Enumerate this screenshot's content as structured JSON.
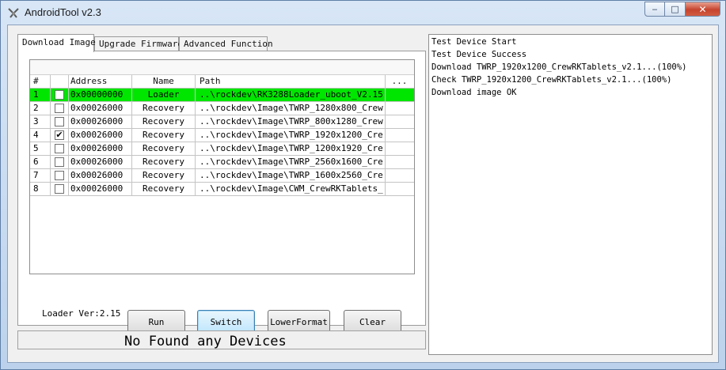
{
  "window": {
    "title": "AndroidTool v2.3"
  },
  "tabs": [
    {
      "label": "Download Image",
      "active": true
    },
    {
      "label": "Upgrade Firmware",
      "active": false
    },
    {
      "label": "Advanced Function",
      "active": false
    }
  ],
  "table": {
    "columns": [
      "#",
      "",
      "Address",
      "Name",
      "Path",
      "..."
    ],
    "rows": [
      {
        "num": "1",
        "checked": false,
        "address": "0x00000000",
        "name": "Loader",
        "path": "..\\rockdev\\RK3288Loader_uboot_V2.15...",
        "highlight": true
      },
      {
        "num": "2",
        "checked": false,
        "address": "0x00026000",
        "name": "Recovery",
        "path": "..\\rockdev\\Image\\TWRP_1280x800_Crew...",
        "highlight": false
      },
      {
        "num": "3",
        "checked": false,
        "address": "0x00026000",
        "name": "Recovery",
        "path": "..\\rockdev\\Image\\TWRP_800x1280_Crew...",
        "highlight": false
      },
      {
        "num": "4",
        "checked": true,
        "address": "0x00026000",
        "name": "Recovery",
        "path": "..\\rockdev\\Image\\TWRP_1920x1200_Cre...",
        "highlight": false
      },
      {
        "num": "5",
        "checked": false,
        "address": "0x00026000",
        "name": "Recovery",
        "path": "..\\rockdev\\Image\\TWRP_1200x1920_Cre...",
        "highlight": false
      },
      {
        "num": "6",
        "checked": false,
        "address": "0x00026000",
        "name": "Recovery",
        "path": "..\\rockdev\\Image\\TWRP_2560x1600_Cre...",
        "highlight": false
      },
      {
        "num": "7",
        "checked": false,
        "address": "0x00026000",
        "name": "Recovery",
        "path": "..\\rockdev\\Image\\TWRP_1600x2560_Cre...",
        "highlight": false
      },
      {
        "num": "8",
        "checked": false,
        "address": "0x00026000",
        "name": "Recovery",
        "path": "..\\rockdev\\Image\\CWM_CrewRKTablets_...",
        "highlight": false
      }
    ]
  },
  "loader_version": "Loader Ver:2.15",
  "buttons": {
    "run": "Run",
    "switch": "Switch",
    "lowerformat": "LowerFormat",
    "clear": "Clear"
  },
  "status": "No Found any Devices",
  "log": [
    "Test Device Start",
    "Test Device Success",
    "Download TWRP_1920x1200_CrewRKTablets_v2.1...(100%)",
    "Check TWRP_1920x1200_CrewRKTablets_v2.1...(100%)",
    "Download image OK"
  ],
  "colors": {
    "highlight_row": "#00e600",
    "close_button": "#c5442e"
  }
}
